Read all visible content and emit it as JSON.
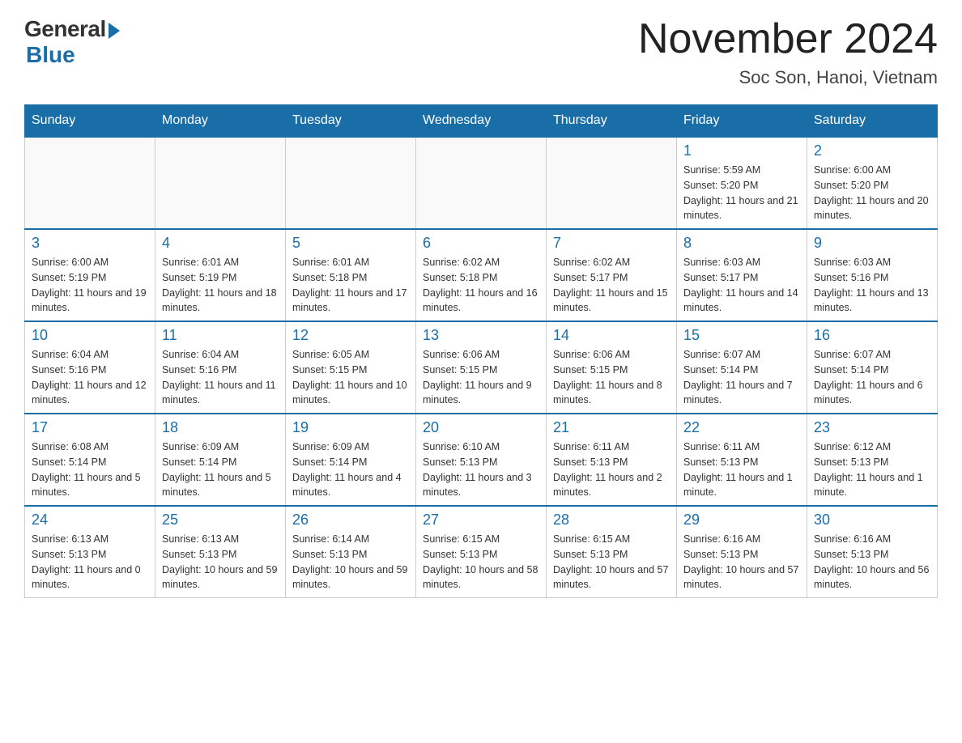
{
  "logo": {
    "general": "General",
    "blue": "Blue"
  },
  "title": "November 2024",
  "subtitle": "Soc Son, Hanoi, Vietnam",
  "days_of_week": [
    "Sunday",
    "Monday",
    "Tuesday",
    "Wednesday",
    "Thursday",
    "Friday",
    "Saturday"
  ],
  "weeks": [
    [
      {
        "day": "",
        "info": ""
      },
      {
        "day": "",
        "info": ""
      },
      {
        "day": "",
        "info": ""
      },
      {
        "day": "",
        "info": ""
      },
      {
        "day": "",
        "info": ""
      },
      {
        "day": "1",
        "info": "Sunrise: 5:59 AM\nSunset: 5:20 PM\nDaylight: 11 hours and 21 minutes."
      },
      {
        "day": "2",
        "info": "Sunrise: 6:00 AM\nSunset: 5:20 PM\nDaylight: 11 hours and 20 minutes."
      }
    ],
    [
      {
        "day": "3",
        "info": "Sunrise: 6:00 AM\nSunset: 5:19 PM\nDaylight: 11 hours and 19 minutes."
      },
      {
        "day": "4",
        "info": "Sunrise: 6:01 AM\nSunset: 5:19 PM\nDaylight: 11 hours and 18 minutes."
      },
      {
        "day": "5",
        "info": "Sunrise: 6:01 AM\nSunset: 5:18 PM\nDaylight: 11 hours and 17 minutes."
      },
      {
        "day": "6",
        "info": "Sunrise: 6:02 AM\nSunset: 5:18 PM\nDaylight: 11 hours and 16 minutes."
      },
      {
        "day": "7",
        "info": "Sunrise: 6:02 AM\nSunset: 5:17 PM\nDaylight: 11 hours and 15 minutes."
      },
      {
        "day": "8",
        "info": "Sunrise: 6:03 AM\nSunset: 5:17 PM\nDaylight: 11 hours and 14 minutes."
      },
      {
        "day": "9",
        "info": "Sunrise: 6:03 AM\nSunset: 5:16 PM\nDaylight: 11 hours and 13 minutes."
      }
    ],
    [
      {
        "day": "10",
        "info": "Sunrise: 6:04 AM\nSunset: 5:16 PM\nDaylight: 11 hours and 12 minutes."
      },
      {
        "day": "11",
        "info": "Sunrise: 6:04 AM\nSunset: 5:16 PM\nDaylight: 11 hours and 11 minutes."
      },
      {
        "day": "12",
        "info": "Sunrise: 6:05 AM\nSunset: 5:15 PM\nDaylight: 11 hours and 10 minutes."
      },
      {
        "day": "13",
        "info": "Sunrise: 6:06 AM\nSunset: 5:15 PM\nDaylight: 11 hours and 9 minutes."
      },
      {
        "day": "14",
        "info": "Sunrise: 6:06 AM\nSunset: 5:15 PM\nDaylight: 11 hours and 8 minutes."
      },
      {
        "day": "15",
        "info": "Sunrise: 6:07 AM\nSunset: 5:14 PM\nDaylight: 11 hours and 7 minutes."
      },
      {
        "day": "16",
        "info": "Sunrise: 6:07 AM\nSunset: 5:14 PM\nDaylight: 11 hours and 6 minutes."
      }
    ],
    [
      {
        "day": "17",
        "info": "Sunrise: 6:08 AM\nSunset: 5:14 PM\nDaylight: 11 hours and 5 minutes."
      },
      {
        "day": "18",
        "info": "Sunrise: 6:09 AM\nSunset: 5:14 PM\nDaylight: 11 hours and 5 minutes."
      },
      {
        "day": "19",
        "info": "Sunrise: 6:09 AM\nSunset: 5:14 PM\nDaylight: 11 hours and 4 minutes."
      },
      {
        "day": "20",
        "info": "Sunrise: 6:10 AM\nSunset: 5:13 PM\nDaylight: 11 hours and 3 minutes."
      },
      {
        "day": "21",
        "info": "Sunrise: 6:11 AM\nSunset: 5:13 PM\nDaylight: 11 hours and 2 minutes."
      },
      {
        "day": "22",
        "info": "Sunrise: 6:11 AM\nSunset: 5:13 PM\nDaylight: 11 hours and 1 minute."
      },
      {
        "day": "23",
        "info": "Sunrise: 6:12 AM\nSunset: 5:13 PM\nDaylight: 11 hours and 1 minute."
      }
    ],
    [
      {
        "day": "24",
        "info": "Sunrise: 6:13 AM\nSunset: 5:13 PM\nDaylight: 11 hours and 0 minutes."
      },
      {
        "day": "25",
        "info": "Sunrise: 6:13 AM\nSunset: 5:13 PM\nDaylight: 10 hours and 59 minutes."
      },
      {
        "day": "26",
        "info": "Sunrise: 6:14 AM\nSunset: 5:13 PM\nDaylight: 10 hours and 59 minutes."
      },
      {
        "day": "27",
        "info": "Sunrise: 6:15 AM\nSunset: 5:13 PM\nDaylight: 10 hours and 58 minutes."
      },
      {
        "day": "28",
        "info": "Sunrise: 6:15 AM\nSunset: 5:13 PM\nDaylight: 10 hours and 57 minutes."
      },
      {
        "day": "29",
        "info": "Sunrise: 6:16 AM\nSunset: 5:13 PM\nDaylight: 10 hours and 57 minutes."
      },
      {
        "day": "30",
        "info": "Sunrise: 6:16 AM\nSunset: 5:13 PM\nDaylight: 10 hours and 56 minutes."
      }
    ]
  ]
}
